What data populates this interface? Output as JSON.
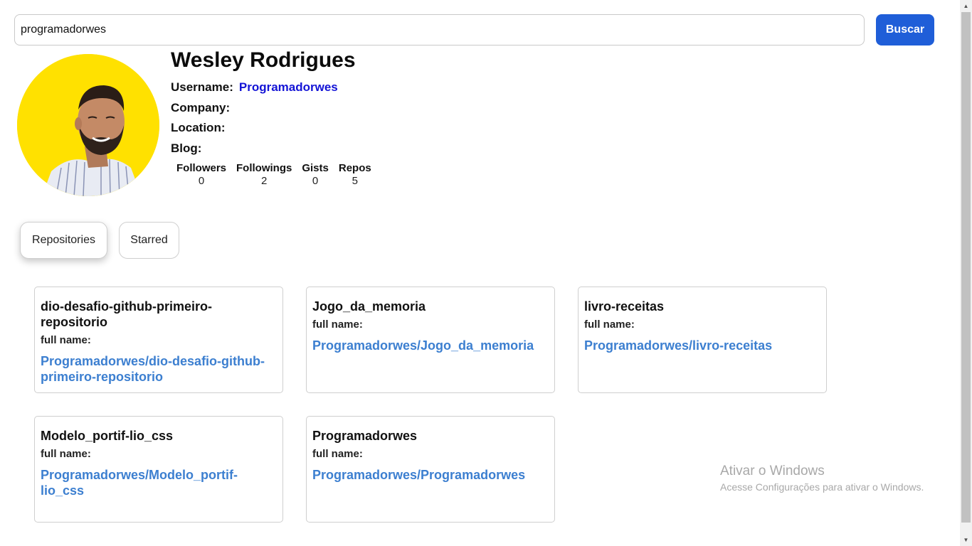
{
  "search": {
    "value": "programadorwes",
    "button_label": "Buscar"
  },
  "profile": {
    "name": "Wesley Rodrigues",
    "username_label": "Username:",
    "username": "Programadorwes",
    "company_label": "Company:",
    "location_label": "Location:",
    "blog_label": "Blog:",
    "avatar_bg": "#ffe100"
  },
  "stats": {
    "followers_label": "Followers",
    "followers": "0",
    "followings_label": "Followings",
    "followings": "2",
    "gists_label": "Gists",
    "gists": "0",
    "repos_label": "Repos",
    "repos": "5"
  },
  "tabs": {
    "repositories": "Repositories",
    "starred": "Starred"
  },
  "repos": [
    {
      "name": "dio-desafio-github-primeiro-repositorio",
      "fullname_label": "full name:",
      "fullname": "Programadorwes/dio-desafio-github-primeiro-repositorio"
    },
    {
      "name": "Jogo_da_memoria",
      "fullname_label": "full name:",
      "fullname": "Programadorwes/Jogo_da_memoria"
    },
    {
      "name": "livro-receitas",
      "fullname_label": "full name:",
      "fullname": "Programadorwes/livro-receitas"
    },
    {
      "name": "Modelo_portif-lio_css",
      "fullname_label": "full name:",
      "fullname": "Programadorwes/Modelo_portif-lio_css"
    },
    {
      "name": "Programadorwes",
      "fullname_label": "full name:",
      "fullname": "Programadorwes/Programadorwes"
    }
  ],
  "watermark": {
    "title": "Ativar o Windows",
    "subtitle": "Acesse Configurações para ativar o Windows."
  },
  "colors": {
    "accent": "#1f5ed8",
    "username_link": "#1313d6",
    "repo_link": "#3c7fd0"
  }
}
